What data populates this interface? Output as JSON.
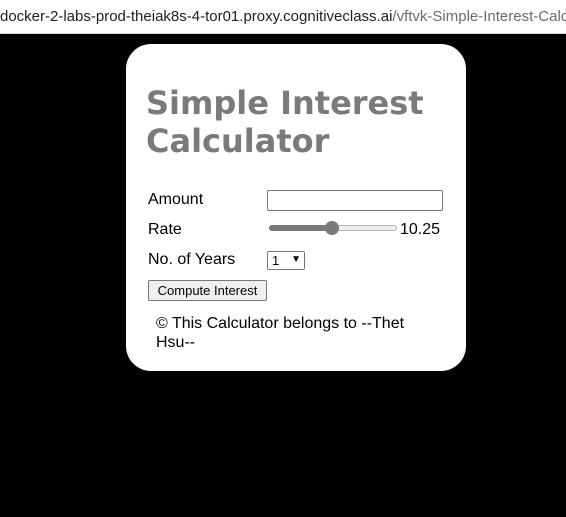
{
  "browser": {
    "url_host": "docker-2-labs-prod-theiak8s-4-tor01.proxy.cognitiveclass.ai",
    "url_path": "/vftvk-Simple-Interest-Calculator/"
  },
  "app": {
    "title": "Simple Interest Calculator",
    "amount_label": "Amount",
    "amount_value": "",
    "rate_label": "Rate",
    "rate_value": "10.25",
    "rate_slider_fraction": 0.49,
    "years_label": "No. of Years",
    "years_selected": "1",
    "compute_label": "Compute Interest",
    "footer": "© This Calculator belongs to --Thet Hsu--"
  }
}
